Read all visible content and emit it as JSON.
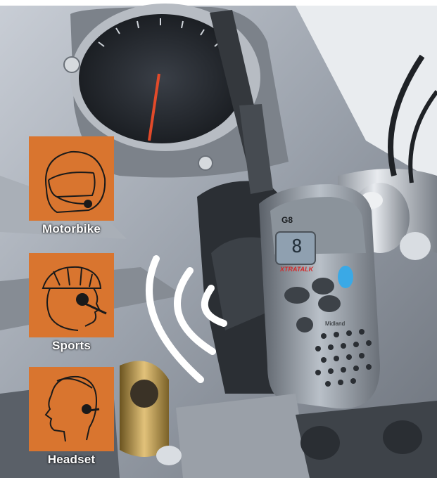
{
  "badges": [
    {
      "label": "Motorbike",
      "icon": "motorcycle-helmet-icon"
    },
    {
      "label": "Sports",
      "icon": "sports-helmet-headset-icon"
    },
    {
      "label": "Headset",
      "icon": "person-headset-icon"
    }
  ],
  "device": {
    "model": "G8",
    "brand": "XTRATALK",
    "display": "8",
    "maker": "Midland"
  },
  "colors": {
    "badge": "#d9752f",
    "signal_arcs": "#ffffff"
  }
}
